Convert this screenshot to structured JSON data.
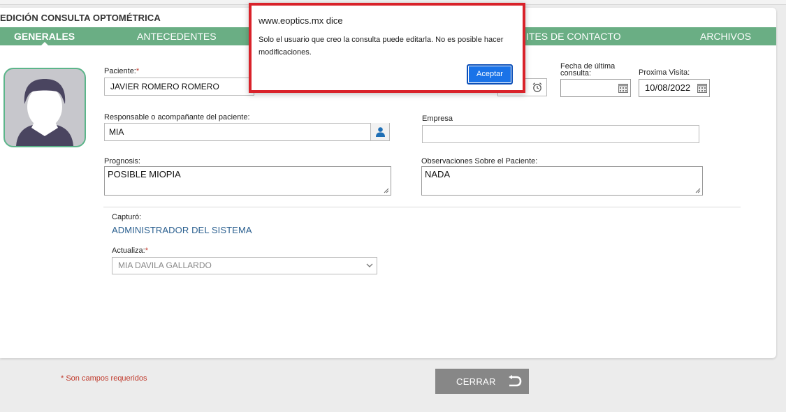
{
  "window": {
    "title": "EDICIÓN CONSULTA OPTOMÉTRICA"
  },
  "tabs": [
    {
      "label": "GENERALES",
      "active": true
    },
    {
      "label": "ANTECEDENTES",
      "active": false
    },
    {
      "label": "ITES DE CONTACTO",
      "active": false
    },
    {
      "label": "ARCHIVOS",
      "active": false
    }
  ],
  "form": {
    "paciente": {
      "label": "Paciente:",
      "required_mark": "*",
      "value": "JAVIER ROMERO ROMERO"
    },
    "fecha_ultima": {
      "label_line1": "Fecha de última",
      "label_line2": "consulta:",
      "value": ""
    },
    "proxima_visita": {
      "label": "Proxima Visita:",
      "value": "10/08/2022"
    },
    "responsable": {
      "label": "Responsable o acompañante del paciente:",
      "value": "MIA"
    },
    "empresa": {
      "label": "Empresa",
      "value": ""
    },
    "prognosis": {
      "label": "Prognosis:",
      "value": "POSIBLE MIOPIA"
    },
    "observaciones": {
      "label": "Observaciones Sobre el Paciente:",
      "value": "NADA"
    },
    "capturo": {
      "label": "Capturó:",
      "value": "ADMINISTRADOR DEL SISTEMA"
    },
    "actualiza": {
      "label": "Actualiza:",
      "required_mark": "*",
      "value": "MIA DAVILA GALLARDO"
    }
  },
  "footer": {
    "required_note": "* Son campos requeridos",
    "close_label": "CERRAR"
  },
  "dialog": {
    "title": "www.eoptics.mx dice",
    "message": "Solo el usuario que creo la consulta puede editarla. No es posible hacer modificaciones.",
    "accept_label": "Aceptar"
  },
  "colors": {
    "tab_bar": "#6aae84",
    "accent_blue": "#1a73e8",
    "required_red": "#c0392b",
    "highlight_border": "#d9222a",
    "link_blue": "#2a5f8f"
  },
  "icons": [
    "avatar-placeholder-icon",
    "person-icon",
    "alarm-clock-icon",
    "calendar-icon",
    "chevron-down-icon",
    "return-arrow-icon"
  ]
}
